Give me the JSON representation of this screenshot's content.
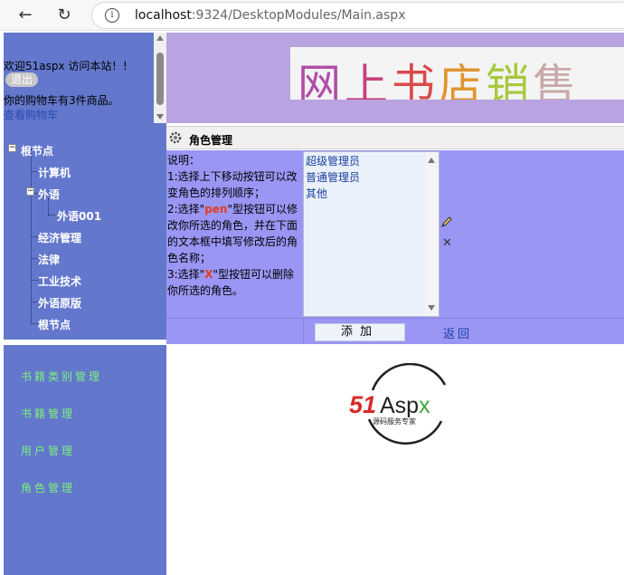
{
  "browser": {
    "back_label": "←",
    "reload_label": "↻",
    "info_label": "i",
    "url_host": "localhost",
    "url_rest": ":9324/DesktopModules/Main.aspx"
  },
  "sidebar": {
    "welcome": "欢迎51aspx 访问本站！！",
    "logout_label": "退出",
    "cart_info": "你的购物车有3件商品。",
    "cart_link": "查看购物车",
    "tree": {
      "root": "根节点",
      "computer": "计算机",
      "foreign": "外语",
      "foreign001": "外语001",
      "economy": "经济管理",
      "law": "法律",
      "industry": "工业技术",
      "original": "外语原版",
      "root2": "根节点",
      "minus": "−"
    },
    "menu": {
      "category": "书籍类别管理",
      "books": "书籍管理",
      "users": "用户管理",
      "roles": "角色管理"
    }
  },
  "header": {
    "banner_chars": [
      "网",
      "上",
      "书",
      "店",
      "销",
      "售"
    ]
  },
  "content": {
    "title": "角色管理",
    "desc": {
      "l1": "说明：",
      "l2": "1:选择上下移动按钮可以改变角色的排列顺序；",
      "l3a": "2:选择\"",
      "l3b": "pen",
      "l3c": "\"型按钮可以修改你所选的角色，并在下面的文本框中填写修改后的角色名称；",
      "l4a": "3:选择\"",
      "l4b": "X",
      "l4c": "\"型按钮可以删除你所选的角色。"
    },
    "roles": [
      "超级管理员",
      "普通管理员",
      "其他"
    ],
    "delete_icon_label": "✕",
    "add_label": "添加",
    "back_label": "返回"
  },
  "logo": {
    "brand_a": "51",
    "brand_b": "Aspx",
    "tagline": "源码服务专家"
  },
  "colors": {
    "sidebar_bg": "#6377cc",
    "header_bg": "#b9a3e0",
    "panel_bg": "#9a96f4",
    "menu_text": "#7cf07c",
    "logo_red": "#d92a2a",
    "logo_green": "#3aa536"
  }
}
